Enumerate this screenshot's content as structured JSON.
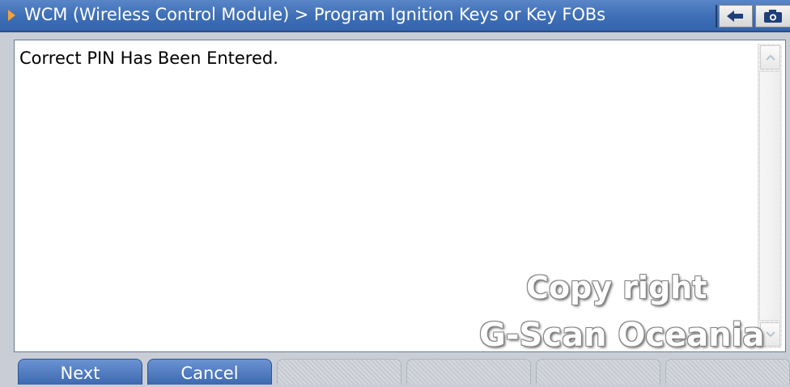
{
  "titlebar": {
    "title": "WCM (Wireless Control Module) > Program Ignition Keys or Key FOBs",
    "back_icon": "back-arrow-icon",
    "camera_icon": "camera-icon"
  },
  "content": {
    "message": "Correct PIN Has Been Entered."
  },
  "watermark": {
    "line1": "Copy right",
    "line2": "G-Scan Oceania"
  },
  "buttons": {
    "next_label": "Next",
    "cancel_label": "Cancel"
  },
  "colors": {
    "titlebar": "#3f6fb6",
    "accent_arrow": "#f0a23a",
    "active_button": "#4a76bc"
  }
}
